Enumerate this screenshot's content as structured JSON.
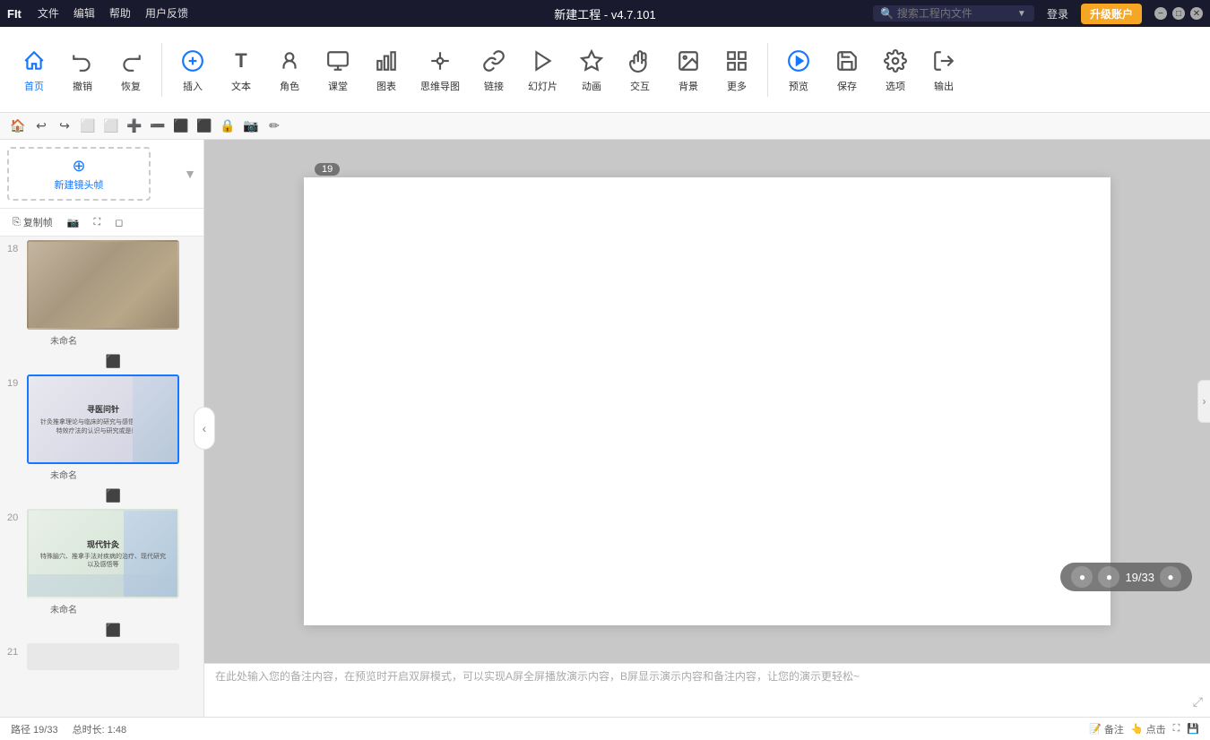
{
  "titlebar": {
    "app_name": "FIt",
    "menus": [
      "文件",
      "编辑",
      "帮助",
      "用户反馈"
    ],
    "title": "新建工程 - v4.7.101",
    "search_placeholder": "搜索工程内文件",
    "login_label": "登录",
    "upgrade_label": "升级账户"
  },
  "toolbar": {
    "groups": [
      {
        "items": [
          {
            "id": "home",
            "label": "首页",
            "icon": "🏠"
          },
          {
            "id": "undo",
            "label": "撤销",
            "icon": "↩"
          },
          {
            "id": "redo",
            "label": "恢复",
            "icon": "↪"
          }
        ]
      },
      {
        "items": [
          {
            "id": "insert",
            "label": "插入",
            "icon": "⊕"
          },
          {
            "id": "text",
            "label": "文本",
            "icon": "T"
          },
          {
            "id": "role",
            "label": "角色",
            "icon": "👤"
          },
          {
            "id": "classroom",
            "label": "课堂",
            "icon": "🖥"
          },
          {
            "id": "chart",
            "label": "图表",
            "icon": "📊"
          },
          {
            "id": "mindmap",
            "label": "思维导图",
            "icon": "🔗"
          },
          {
            "id": "link",
            "label": "链接",
            "icon": "🔗"
          },
          {
            "id": "slide",
            "label": "幻灯片",
            "icon": "📽"
          },
          {
            "id": "animation",
            "label": "动画",
            "icon": "⭐"
          },
          {
            "id": "interact",
            "label": "交互",
            "icon": "✋"
          },
          {
            "id": "background",
            "label": "背景",
            "icon": "🖼"
          },
          {
            "id": "more",
            "label": "更多",
            "icon": "⊞"
          }
        ]
      },
      {
        "items": [
          {
            "id": "preview",
            "label": "预览",
            "icon": "▶"
          },
          {
            "id": "save",
            "label": "保存",
            "icon": "💾"
          },
          {
            "id": "options",
            "label": "选项",
            "icon": "⚙"
          },
          {
            "id": "export",
            "label": "输出",
            "icon": "⬆"
          }
        ]
      }
    ]
  },
  "second_toolbar": {
    "icons": [
      "🏠",
      "🔄",
      "🔄",
      "⬜",
      "⬜",
      "➕",
      "➖",
      "⬛",
      "⬛",
      "⬛",
      "⬛",
      "✏"
    ]
  },
  "slides": {
    "new_frame_label": "新建镜头帧",
    "action_buttons": [
      "复制帧",
      "📷",
      "⛶",
      "◻"
    ],
    "items": [
      {
        "num": 18,
        "name": "未命名",
        "thumb_type": "image",
        "active": false
      },
      {
        "num": 19,
        "name": "未命名",
        "thumb_type": "text",
        "active": true,
        "title": "寻医问针",
        "content": "针灸推拿理论与临床的研究与感悟；针灸推拿特效疗法的认识与研究或是感悟等"
      },
      {
        "num": 20,
        "name": "未命名",
        "thumb_type": "text",
        "active": false,
        "title": "现代针灸",
        "content": "特殊腧穴、推拿手法对疾病的治疗、现代研究以及感悟等"
      },
      {
        "num": 21,
        "name": "",
        "thumb_type": "empty"
      }
    ]
  },
  "canvas": {
    "slide_num": "19",
    "badge": "19"
  },
  "playback": {
    "current": "19",
    "total": "33",
    "display": "19/33"
  },
  "notes": {
    "placeholder": "在此处输入您的备注内容，在预览时开启双屏模式，可以实现A屏全屏播放演示内容，B屏显示演示内容和备注内容，让您的演示更轻松~"
  },
  "statusbar": {
    "path": "路径 19/33",
    "total_length": "总时长: 1:48",
    "notes_btn": "备注",
    "points_btn": "点击"
  }
}
